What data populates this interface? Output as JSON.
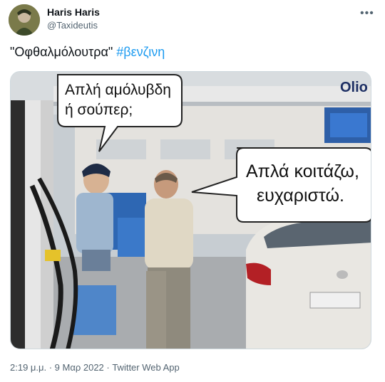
{
  "user": {
    "display_name": "Haris Haris",
    "handle": "@Taxideutis",
    "avatar_icon": "avatar-image"
  },
  "more_icon": "more-dots-icon",
  "tweet": {
    "text": "\"Οφθαλμόλουτρα\" ",
    "hashtag": "#βενζινη",
    "hashtag_color": "#1d9bf0"
  },
  "media": {
    "bubble_left": [
      "Απλή αμόλυβδη",
      "ή σούπερ;"
    ],
    "bubble_right": [
      "Απλά κοιτάζω,",
      "ευχαριστώ."
    ],
    "corner_logo": "Olio"
  },
  "footer": {
    "timestamp": "2:19 μ.μ. · 9 Μαρ 2022 · Twitter Web App"
  }
}
